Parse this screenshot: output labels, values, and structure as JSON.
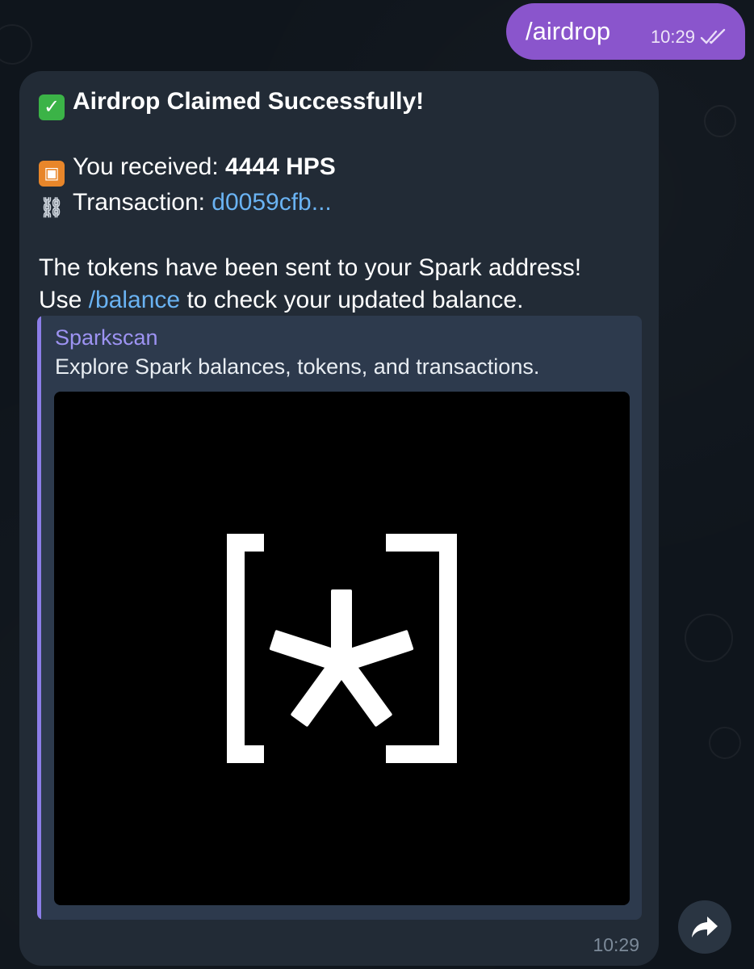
{
  "outgoing": {
    "text": "/airdrop",
    "time": "10:29",
    "status_icon": "double-check-icon"
  },
  "incoming": {
    "title_emoji": "✅",
    "title": "Airdrop Claimed Successfully!",
    "received_emoji": "🎁",
    "received_label": "You received: ",
    "received_value": "4444 HPS",
    "tx_emoji": "🔗",
    "tx_label": "Transaction: ",
    "tx_link": "d0059cfb...",
    "body_line1": "The tokens have been sent to your Spark address!",
    "body_use": "Use ",
    "body_command": "/balance",
    "body_rest": " to check your updated balance.",
    "preview": {
      "site": "Sparkscan",
      "description": "Explore Spark balances, tokens, and transactions.",
      "image_icon": "sparkscan-logo"
    },
    "time": "10:29"
  },
  "actions": {
    "forward_icon": "forward-arrow-icon"
  },
  "colors": {
    "outgoing_bubble": "#8a55cc",
    "incoming_bubble": "#222b36",
    "link": "#6ab3f3",
    "preview_accent": "#8c7ee8"
  }
}
